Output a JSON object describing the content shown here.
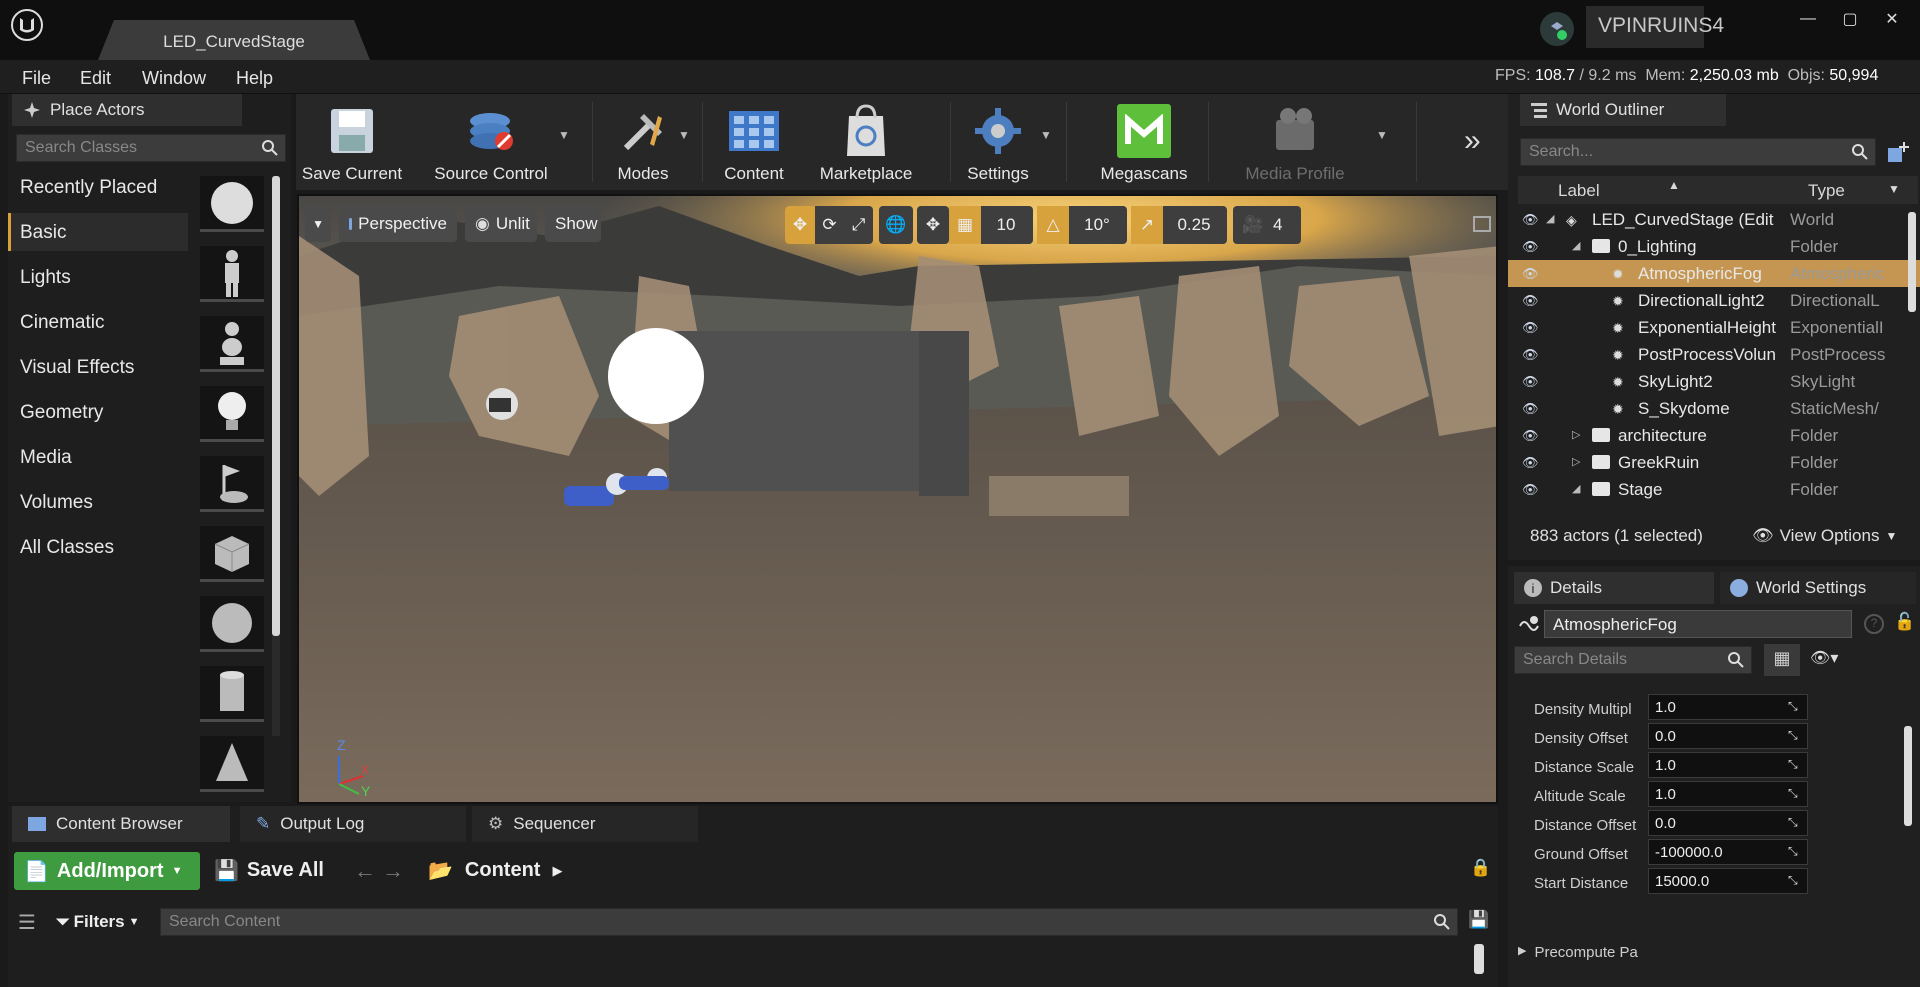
{
  "window": {
    "doc_tab": "LED_CurvedStage",
    "project": "VPINRUINS4"
  },
  "menu": [
    "File",
    "Edit",
    "Window",
    "Help"
  ],
  "stats": {
    "fps_label": "FPS:",
    "fps": "108.7",
    "ms": "/ 9.2 ms",
    "mem_label": "Mem:",
    "mem": "2,250.03 mb",
    "objs_label": "Objs:",
    "objs": "50,994"
  },
  "place_actors": {
    "title": "Place Actors",
    "search_placeholder": "Search Classes",
    "categories": [
      "Recently Placed",
      "Basic",
      "Lights",
      "Cinematic",
      "Visual Effects",
      "Geometry",
      "Media",
      "Volumes",
      "All Classes"
    ],
    "selected_category": "Basic"
  },
  "toolbar": {
    "save": "Save Current",
    "source_control": "Source Control",
    "modes": "Modes",
    "content": "Content",
    "marketplace": "Marketplace",
    "settings": "Settings",
    "megascans": "Megascans",
    "media_profile": "Media Profile"
  },
  "viewport": {
    "perspective": "Perspective",
    "unlit": "Unlit",
    "show": "Show",
    "grid_snap": "10",
    "rot_snap": "10°",
    "scale_snap": "0.25",
    "cam_speed": "4"
  },
  "outliner": {
    "title": "World Outliner",
    "search_placeholder": "Search...",
    "col_label": "Label",
    "col_type": "Type",
    "rows": [
      {
        "label": "LED_CurvedStage (Edit",
        "type": "World"
      },
      {
        "label": "0_Lighting",
        "type": "Folder"
      },
      {
        "label": "AtmosphericFog",
        "type": "Atmospheric"
      },
      {
        "label": "DirectionalLight2",
        "type": "DirectionalL"
      },
      {
        "label": "ExponentialHeight",
        "type": "ExponentialI"
      },
      {
        "label": "PostProcessVolun",
        "type": "PostProcess"
      },
      {
        "label": "SkyLight2",
        "type": "SkyLight"
      },
      {
        "label": "S_Skydome",
        "type": "StaticMesh/"
      },
      {
        "label": "architecture",
        "type": "Folder"
      },
      {
        "label": "GreekRuin",
        "type": "Folder"
      },
      {
        "label": "Stage",
        "type": "Folder"
      }
    ],
    "status": "883 actors (1 selected)",
    "view_options": "View Options"
  },
  "details": {
    "tab_details": "Details",
    "tab_world": "World Settings",
    "object_name": "AtmosphericFog",
    "search_placeholder": "Search Details",
    "props": [
      {
        "label": "Density Multipl",
        "value": "1.0"
      },
      {
        "label": "Density Offset",
        "value": "0.0"
      },
      {
        "label": "Distance Scale",
        "value": "1.0"
      },
      {
        "label": "Altitude Scale",
        "value": "1.0"
      },
      {
        "label": "Distance Offset",
        "value": "0.0"
      },
      {
        "label": "Ground Offset",
        "value": "-100000.0"
      },
      {
        "label": "Start Distance",
        "value": "15000.0"
      }
    ],
    "section": "Precompute Pa"
  },
  "bottom": {
    "tabs": [
      "Content Browser",
      "Output Log",
      "Sequencer"
    ],
    "add_import": "Add/Import",
    "save_all": "Save All",
    "path": "Content",
    "filters": "Filters",
    "search_placeholder": "Search Content"
  },
  "colors": {
    "accent_orange": "#d7a23c",
    "selected_row": "#c49652",
    "green_button": "#3f9b3f",
    "megascans_green": "#5ec03a"
  }
}
